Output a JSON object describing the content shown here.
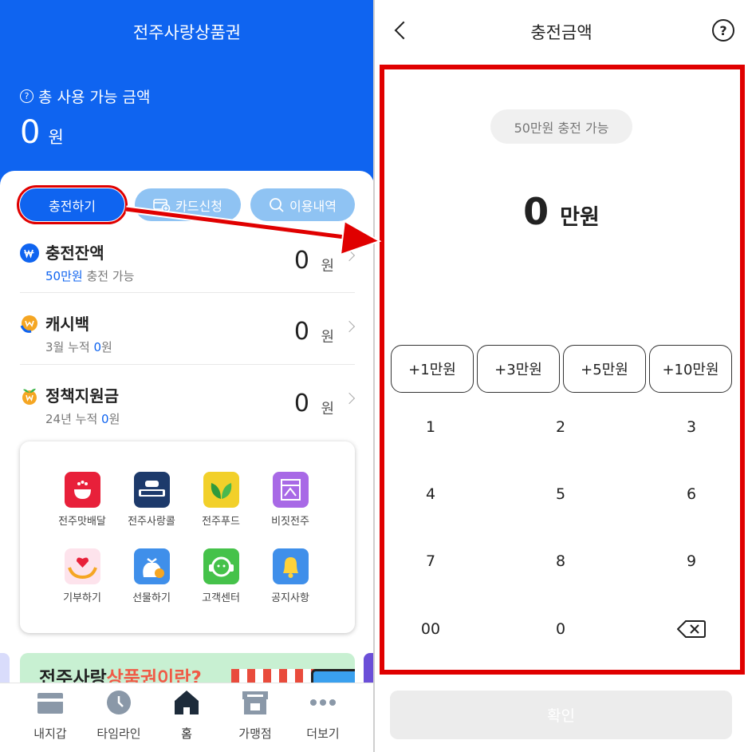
{
  "left": {
    "app_title": "전주사랑상품권",
    "total_label": "총 사용 가능 금액",
    "total_amount": "0",
    "total_unit": "원",
    "actions": {
      "charge": "충전하기",
      "card_apply": "카드신청",
      "history": "이용내역"
    },
    "rows": [
      {
        "title": "충전잔액",
        "sub_highlight": "50만원",
        "sub_rest": " 충전 가능",
        "amount": "0",
        "unit": "원",
        "icon": "won-coin-icon"
      },
      {
        "title": "캐시백",
        "sub_prefix": "3월 누적 ",
        "sub_highlight": "0",
        "sub_rest": "원",
        "amount": "0",
        "unit": "원",
        "icon": "cashback-icon"
      },
      {
        "title": "정책지원금",
        "sub_prefix": "24년 누적 ",
        "sub_highlight": "0",
        "sub_rest": "원",
        "amount": "0",
        "unit": "원",
        "icon": "sprout-coin-icon"
      }
    ],
    "menu": [
      {
        "label": "전주맛배달",
        "icon": "food-delivery-icon",
        "color": "#e8203a"
      },
      {
        "label": "전주사랑콜",
        "icon": "taxi-call-icon",
        "color": "#1d3a6b"
      },
      {
        "label": "전주푸드",
        "icon": "leaf-icon",
        "color": "#f2d02a"
      },
      {
        "label": "비짓전주",
        "icon": "visit-icon",
        "color": "#a869e6"
      },
      {
        "label": "기부하기",
        "icon": "donation-heart-icon",
        "color": "#fde3ec"
      },
      {
        "label": "선물하기",
        "icon": "gift-money-icon",
        "color": "#3f8fea"
      },
      {
        "label": "고객센터",
        "icon": "headset-icon",
        "color": "#45c24a"
      },
      {
        "label": "공지사항",
        "icon": "bell-icon",
        "color": "#3f8fea"
      }
    ],
    "banner": {
      "text_dark": "전주사랑",
      "text_red": "상품권이란?"
    },
    "tabs": [
      {
        "label": "내지갑",
        "icon": "wallet-icon"
      },
      {
        "label": "타임라인",
        "icon": "clock-icon"
      },
      {
        "label": "홈",
        "icon": "home-icon",
        "active": true
      },
      {
        "label": "가맹점",
        "icon": "store-icon"
      },
      {
        "label": "더보기",
        "icon": "more-icon"
      }
    ],
    "colors": {
      "brand_blue": "#0f64f0",
      "light_blue": "#8fc3f3",
      "highlight_red": "#e00000"
    }
  },
  "right": {
    "title": "충전금액",
    "available_chip": "50만원 충전 가능",
    "amount": "0",
    "amount_unit": "만원",
    "quick_add": [
      "+1만원",
      "+3만원",
      "+5만원",
      "+10만원"
    ],
    "keypad": [
      "1",
      "2",
      "3",
      "4",
      "5",
      "6",
      "7",
      "8",
      "9",
      "00",
      "0"
    ],
    "backspace_icon": "backspace-icon",
    "confirm": "확인"
  }
}
